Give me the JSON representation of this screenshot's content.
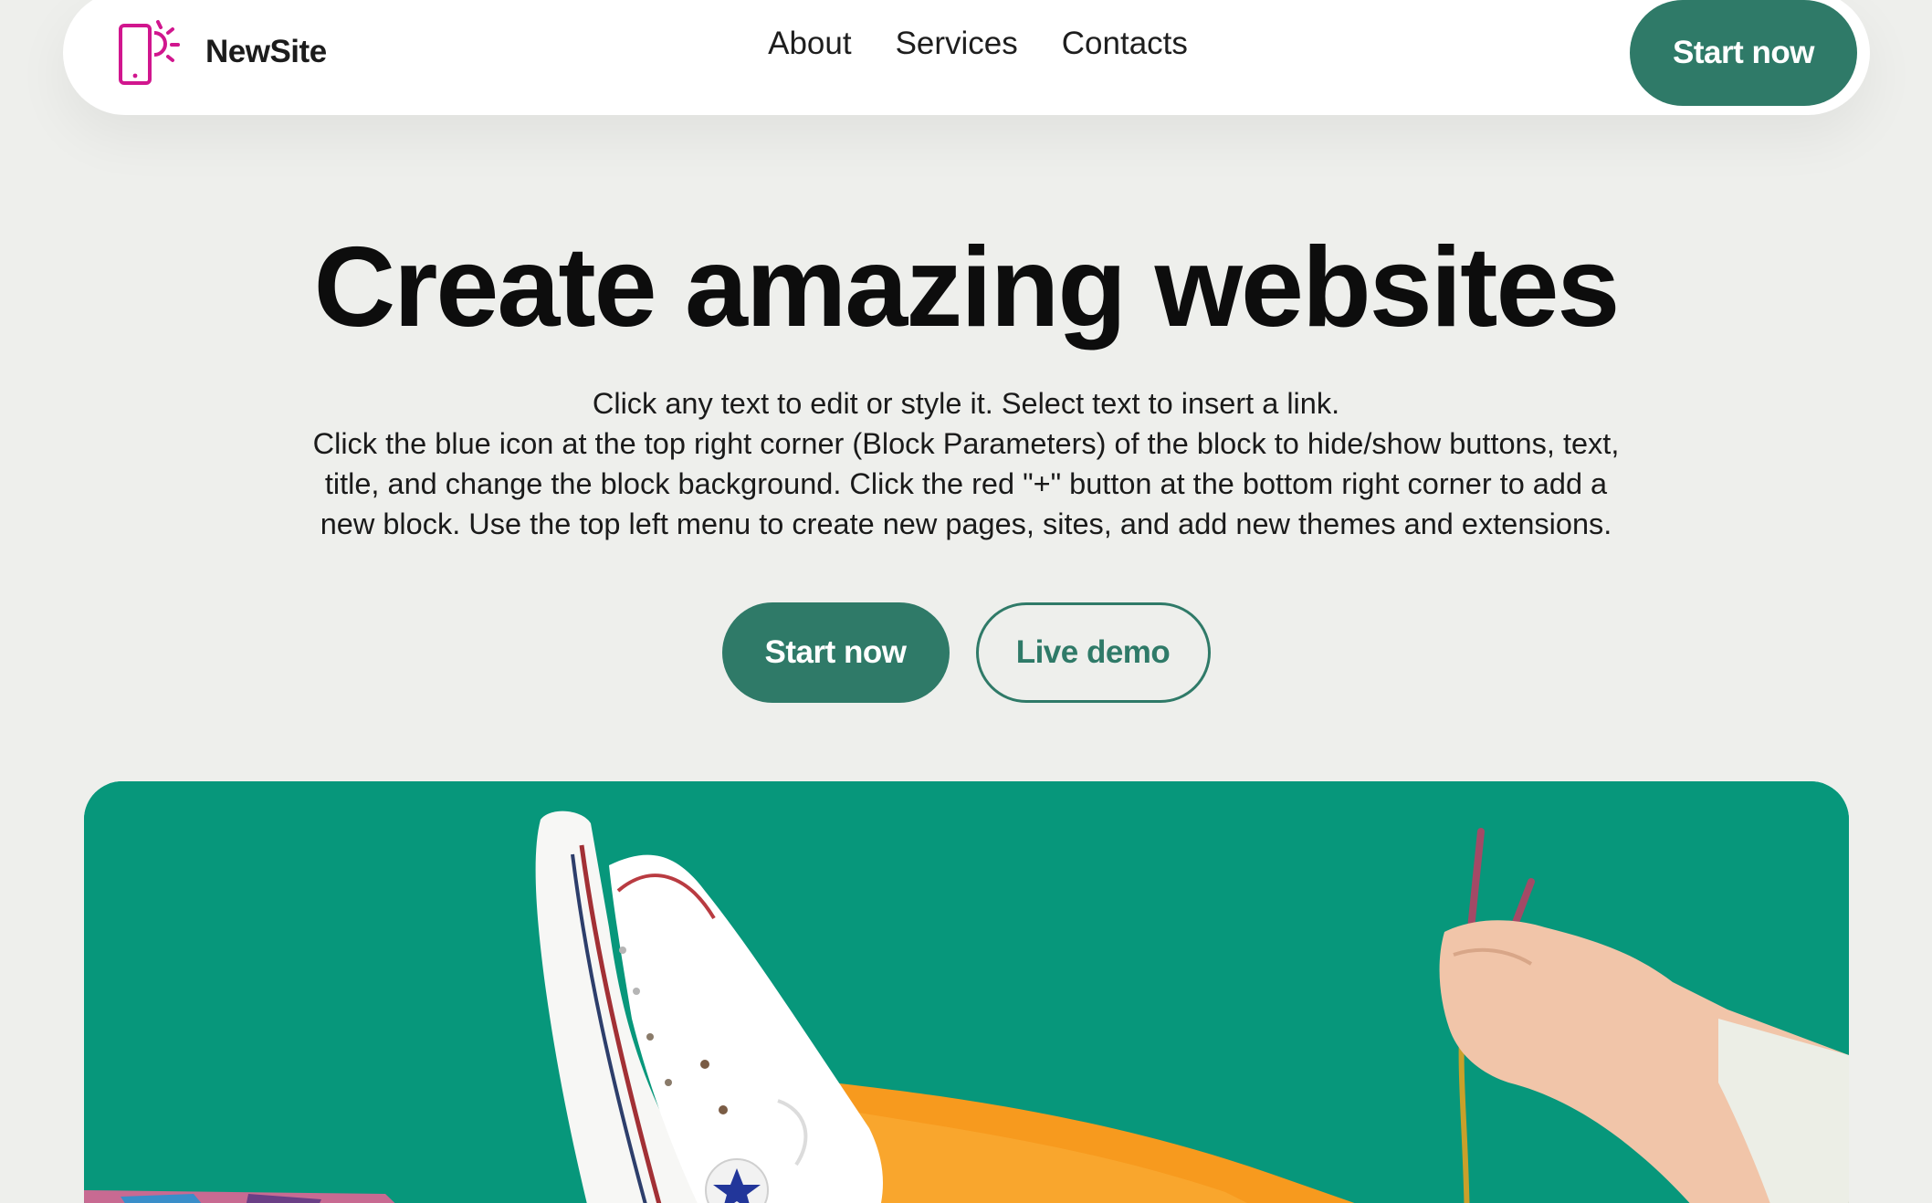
{
  "navbar": {
    "brand_name": "NewSite",
    "brand_icon": "phone-sun-logo-icon",
    "links": [
      "About",
      "Services",
      "Contacts"
    ],
    "cta_label": "Start now"
  },
  "hero": {
    "title": "Create amazing websites",
    "description_line1": "Click any text to edit or style it. Select text to insert a link.",
    "description_line2": "Click the blue icon at the top right corner (Block Parameters) of the block to hide/show buttons, text, title, and change the block background. Click the red \"+\" button at the bottom right corner to add a new block. Use the top left menu to create new pages, sites, and add new themes and extensions.",
    "primary_button": "Start now",
    "secondary_button": "Live demo",
    "image_alt": "sneaker-and-hand-photo"
  },
  "colors": {
    "accent": "#2f7a68",
    "background": "#eeefec",
    "logo": "#d1168e",
    "image_bg": "#07977b"
  }
}
